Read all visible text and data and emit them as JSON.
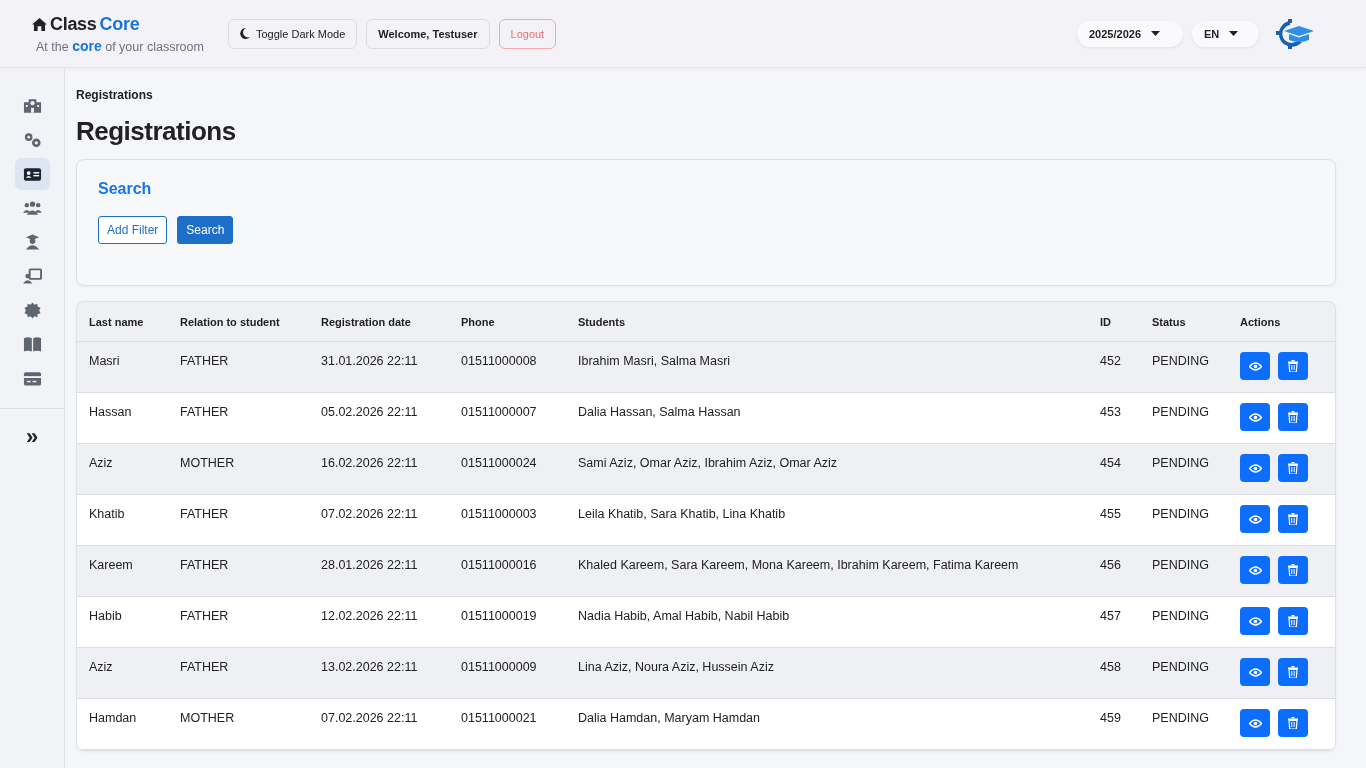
{
  "brand": {
    "name_part_1": "Class",
    "name_part_2": "Core",
    "tagline_before": "At the",
    "tagline_word": "core",
    "tagline_after": "of your classroom"
  },
  "header": {
    "dark_mode_button": "Toggle Dark Mode",
    "welcome": "Welcome, Testuser",
    "logout": "Logout",
    "year_select": "2025/2026",
    "language_select": "EN"
  },
  "sidebar": {
    "items": [
      {
        "selected": false
      },
      {
        "selected": false
      },
      {
        "selected": true
      },
      {
        "selected": false
      },
      {
        "selected": false
      },
      {
        "selected": false
      },
      {
        "selected": false
      },
      {
        "selected": false
      },
      {
        "selected": false
      }
    ],
    "expand": "»"
  },
  "breadcrumb": "Registrations",
  "page_title": "Registrations",
  "search_panel": {
    "title": "Search",
    "add_filter": "Add Filter",
    "search_button": "Search"
  },
  "table": {
    "columns": [
      "Last name",
      "Relation to student",
      "Registration date",
      "Phone",
      "Students",
      "ID",
      "Status",
      "Actions"
    ],
    "rows": [
      {
        "cells": [
          "Masri",
          "FATHER",
          "31.01.2026 22:11",
          "01511000008",
          "Ibrahim Masri, Salma Masri",
          "452",
          "PENDING"
        ]
      },
      {
        "cells": [
          "Hassan",
          "FATHER",
          "05.02.2026 22:11",
          "01511000007",
          "Dalia Hassan, Salma Hassan",
          "453",
          "PENDING"
        ]
      },
      {
        "cells": [
          "Aziz",
          "MOTHER",
          "16.02.2026 22:11",
          "01511000024",
          "Sami Aziz, Omar Aziz, Ibrahim Aziz, Omar Aziz",
          "454",
          "PENDING"
        ]
      },
      {
        "cells": [
          "Khatib",
          "FATHER",
          "07.02.2026 22:11",
          "01511000003",
          "Leila Khatib, Sara Khatib, Lina Khatib",
          "455",
          "PENDING"
        ]
      },
      {
        "cells": [
          "Kareem",
          "FATHER",
          "28.01.2026 22:11",
          "01511000016",
          "Khaled Kareem, Sara Kareem, Mona Kareem, Ibrahim Kareem, Fatima Kareem",
          "456",
          "PENDING"
        ]
      },
      {
        "cells": [
          "Habib",
          "FATHER",
          "12.02.2026 22:11",
          "01511000019",
          "Nadia Habib, Amal Habib, Nabil Habib",
          "457",
          "PENDING"
        ]
      },
      {
        "cells": [
          "Aziz",
          "FATHER",
          "13.02.2026 22:11",
          "01511000009",
          "Lina Aziz, Noura Aziz, Hussein Aziz",
          "458",
          "PENDING"
        ]
      },
      {
        "cells": [
          "Hamdan",
          "MOTHER",
          "07.02.2026 22:11",
          "01511000021",
          "Dalia Hamdan, Maryam Hamdan",
          "459",
          "PENDING"
        ]
      }
    ]
  }
}
